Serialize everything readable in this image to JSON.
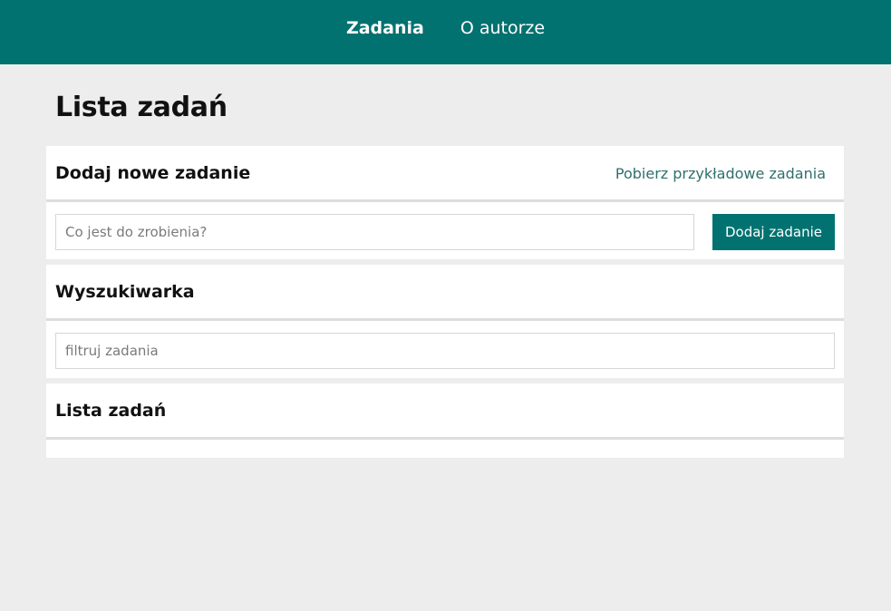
{
  "nav": {
    "items": [
      {
        "label": "Zadania",
        "active": true
      },
      {
        "label": "O autorze",
        "active": false
      }
    ]
  },
  "page": {
    "title": "Lista zadań"
  },
  "add_task": {
    "title": "Dodaj nowe zadanie",
    "sample_link": "Pobierz przykładowe zadania",
    "input_placeholder": "Co jest do zrobienia?",
    "input_value": "",
    "button_label": "Dodaj zadanie"
  },
  "search": {
    "title": "Wyszukiwarka",
    "input_placeholder": "filtruj zadania",
    "input_value": ""
  },
  "task_list": {
    "title": "Lista zadań",
    "items": []
  },
  "colors": {
    "brand": "#017270",
    "background": "#ededed",
    "link": "#2f6f6d"
  }
}
